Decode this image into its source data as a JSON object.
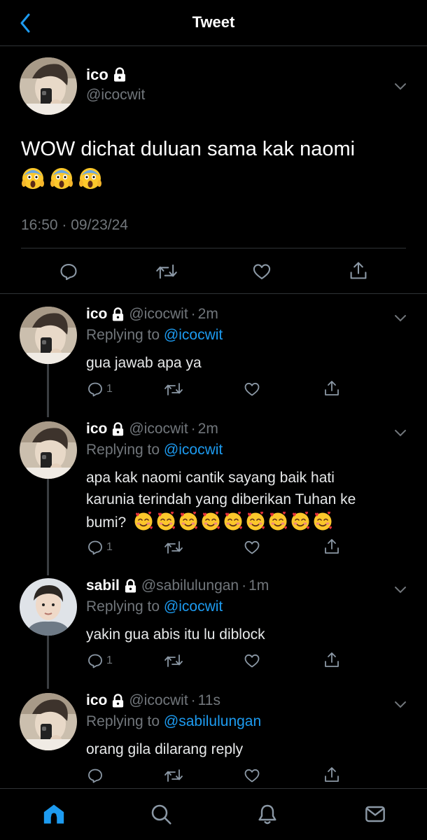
{
  "header": {
    "title": "Tweet"
  },
  "main_tweet": {
    "name": "ico",
    "handle": "@icocwit",
    "text": "WOW dichat duluan sama kak naomi",
    "emojis": [
      "😱",
      "😱",
      "😱"
    ],
    "timestamp": "16:50 · 09/23/24"
  },
  "replies": [
    {
      "name": "ico",
      "handle": "@icocwit",
      "time": "2m",
      "replying_prefix": "Replying to",
      "replying_to": "@icocwit",
      "text": "gua jawab apa ya",
      "reply_count": "1"
    },
    {
      "name": "ico",
      "handle": "@icocwit",
      "time": "2m",
      "replying_prefix": "Replying to",
      "replying_to": "@icocwit",
      "text": "apa kak naomi cantik sayang baik hati karunia terindah yang diberikan Tuhan ke bumi?",
      "emojis": [
        "🥰",
        "🥰",
        "🥰",
        "🥰",
        "🥰",
        "🥰",
        "🥰",
        "🥰",
        "🥰"
      ],
      "reply_count": "1"
    },
    {
      "name": "sabil",
      "handle": "@sabilulungan",
      "time": "1m",
      "replying_prefix": "Replying to",
      "replying_to": "@icocwit",
      "text": "yakin gua abis itu lu diblock",
      "reply_count": "1"
    },
    {
      "name": "ico",
      "handle": "@icocwit",
      "time": "11s",
      "replying_prefix": "Replying to",
      "replying_to": "@sabilulungan",
      "text": "orang gila dilarang reply",
      "reply_count": ""
    }
  ],
  "separator": "·",
  "icons": {
    "back": "chevron-left-icon",
    "lock": "lock-icon",
    "more": "chevron-down-icon",
    "reply": "reply-icon",
    "retweet": "retweet-icon",
    "like": "heart-icon",
    "share": "share-icon",
    "home": "home-icon",
    "search": "search-icon",
    "notifications": "bell-icon",
    "messages": "mail-icon"
  },
  "colors": {
    "background": "#000000",
    "text": "#ffffff",
    "secondary": "#71767b",
    "link": "#1d9bf0",
    "divider": "#2f3336"
  }
}
